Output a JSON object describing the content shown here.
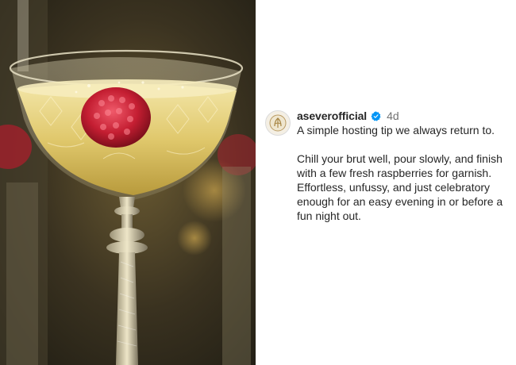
{
  "post": {
    "image_alt": "Coupe glass of sparkling wine with a raspberry",
    "author": {
      "username": "aseverofficial",
      "verified": true,
      "avatar_icon": "brand-logo-icon"
    },
    "timestamp": "4d",
    "caption": {
      "line1": "A simple hosting tip we always return to.",
      "paragraph2": "Chill your brut well, pour slowly, and finish with a few fresh raspberries for garnish. Effortless, unfussy, and just celebratory enough for an easy evening in or before a fun night out."
    }
  },
  "colors": {
    "verified_badge": "#0095f6",
    "username": "#262626",
    "timestamp": "#737373",
    "wine": "#e6d27a",
    "raspberry": "#c8283a"
  }
}
